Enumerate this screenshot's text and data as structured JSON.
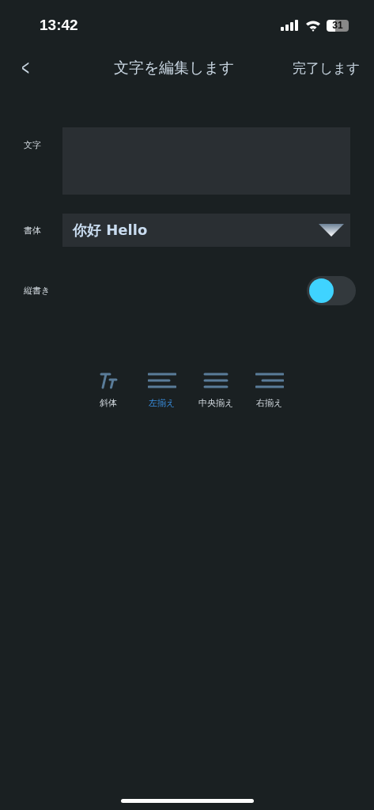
{
  "status_bar": {
    "time": "13:42",
    "battery": "31"
  },
  "nav": {
    "back": "<",
    "title": "文字を編集します",
    "done": "完了します"
  },
  "text_field": {
    "label": "文字"
  },
  "font": {
    "label": "書体",
    "value": "你好 Hello"
  },
  "vertical": {
    "label": "縦書き",
    "on": false
  },
  "tools": [
    {
      "kind": "italic",
      "label": "斜体",
      "selected": false
    },
    {
      "kind": "align-left",
      "label": "左揃え",
      "selected": true
    },
    {
      "kind": "align-center",
      "label": "中央揃え",
      "selected": false
    },
    {
      "kind": "align-right",
      "label": "右揃え",
      "selected": false
    }
  ]
}
